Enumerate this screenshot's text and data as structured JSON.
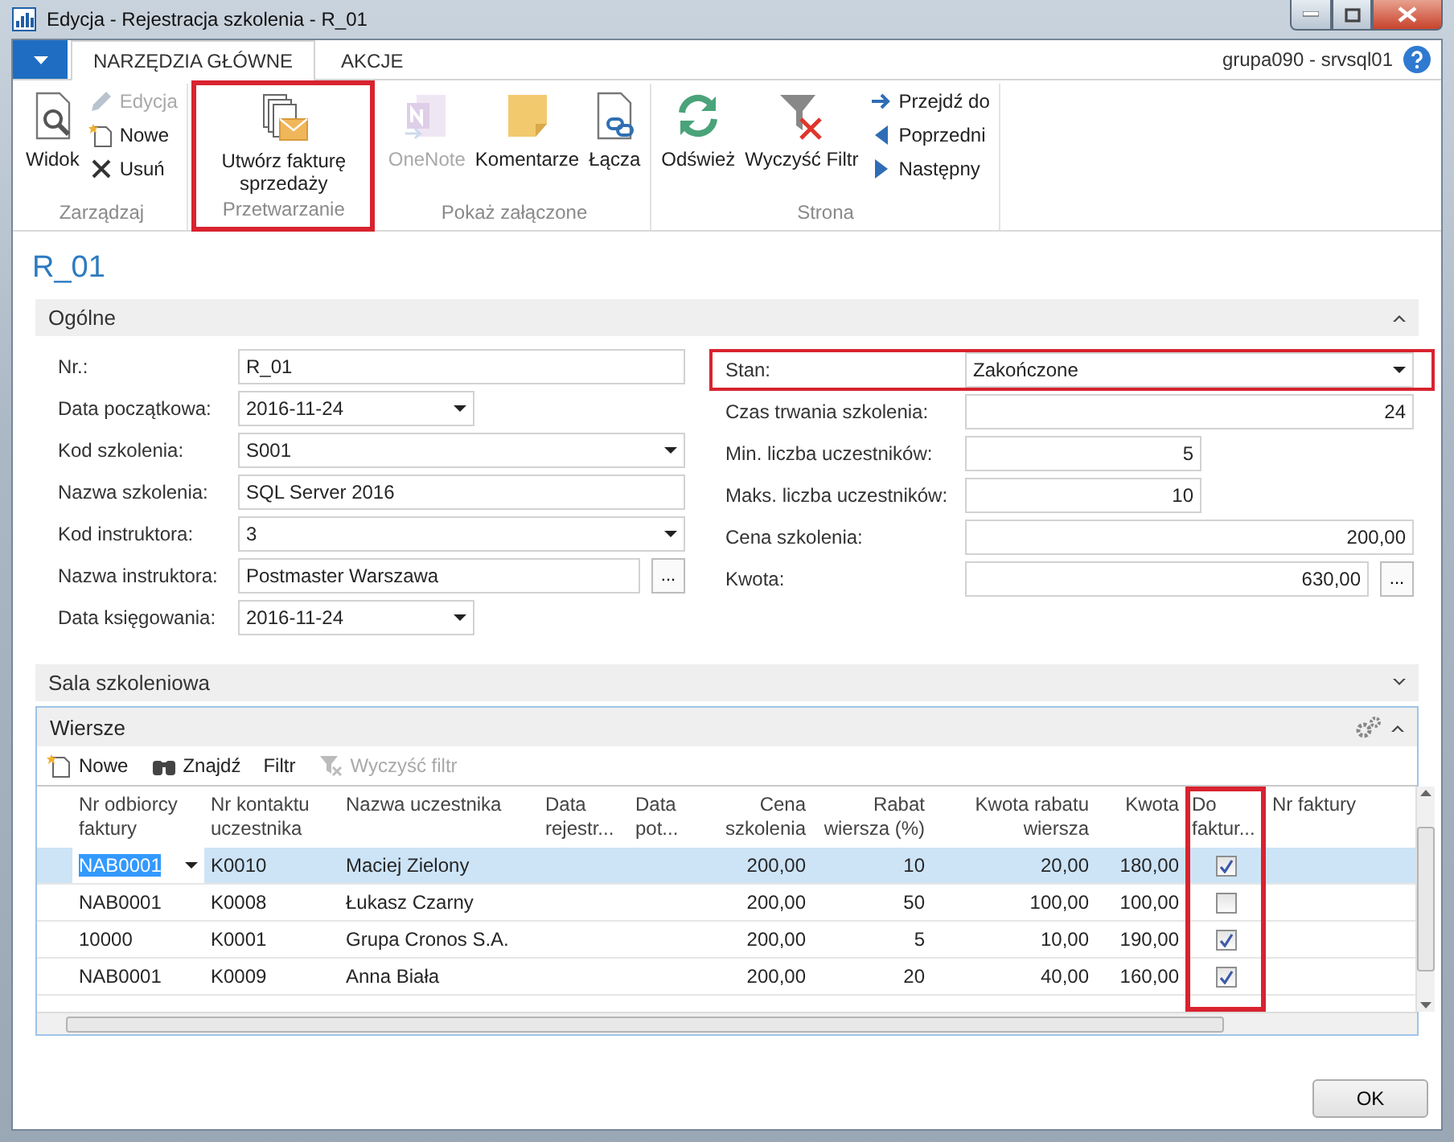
{
  "window": {
    "title": "Edycja - Rejestracja szkolenia - R_01"
  },
  "ribbon_tabs": [
    {
      "label": "NARZĘDZIA GŁÓWNE",
      "selected": true
    },
    {
      "label": "AKCJE",
      "selected": false
    }
  ],
  "user_info": "grupa090 - srvsql01",
  "ribbon_groups": [
    {
      "label": "Zarządzaj",
      "highlighted": false,
      "items": [
        {
          "label": "Widok",
          "kind": "large",
          "disabled": false
        },
        {
          "label": "Edycja",
          "kind": "small",
          "disabled": true
        },
        {
          "label": "Nowe",
          "kind": "small",
          "disabled": false
        },
        {
          "label": "Usuń",
          "kind": "small",
          "disabled": false
        }
      ]
    },
    {
      "label": "Przetwarzanie",
      "highlighted": true,
      "items": [
        {
          "label": "Utwórz fakturę sprzedaży",
          "kind": "large",
          "disabled": false
        }
      ]
    },
    {
      "label": "Pokaż załączone",
      "highlighted": false,
      "items": [
        {
          "label": "OneNote",
          "kind": "large",
          "disabled": true
        },
        {
          "label": "Komentarze",
          "kind": "large",
          "disabled": false
        },
        {
          "label": "Łącza",
          "kind": "large",
          "disabled": false
        }
      ]
    },
    {
      "label": "Strona",
      "highlighted": false,
      "items": [
        {
          "label": "Odśwież",
          "kind": "large",
          "disabled": false
        },
        {
          "label": "Wyczyść Filtr",
          "kind": "large",
          "disabled": false
        },
        {
          "label": "Przejdź do",
          "kind": "small",
          "disabled": false
        },
        {
          "label": "Poprzedni",
          "kind": "small",
          "disabled": false
        },
        {
          "label": "Następny",
          "kind": "small",
          "disabled": false
        }
      ]
    }
  ],
  "page_title": "R_01",
  "general": {
    "title": "Ogólne",
    "expanded": true,
    "left_fields": [
      {
        "label": "Nr.:",
        "value": "R_01",
        "kind": "text",
        "highlighted": false
      },
      {
        "label": "Data początkowa:",
        "value": "2016-11-24",
        "kind": "date",
        "highlighted": false
      },
      {
        "label": "Kod szkolenia:",
        "value": "S001",
        "kind": "dropdown",
        "highlighted": false
      },
      {
        "label": "Nazwa szkolenia:",
        "value": "SQL Server 2016",
        "kind": "text",
        "highlighted": false
      },
      {
        "label": "Kod instruktora:",
        "value": "3",
        "kind": "dropdown",
        "highlighted": false
      },
      {
        "label": "Nazwa instruktora:",
        "value": "Postmaster Warszawa",
        "kind": "lookup",
        "button": "...",
        "highlighted": false
      },
      {
        "label": "Data księgowania:",
        "value": "2016-11-24",
        "kind": "date",
        "highlighted": false
      }
    ],
    "right_fields": [
      {
        "label": "Stan:",
        "value": "Zakończone",
        "kind": "dropdown",
        "highlighted": true
      },
      {
        "label": "Czas trwania szkolenia:",
        "value": "24",
        "kind": "number",
        "highlighted": false
      },
      {
        "label": "Min. liczba uczestników:",
        "value": "5",
        "kind": "short_number",
        "highlighted": false
      },
      {
        "label": "Maks. liczba uczestników:",
        "value": "10",
        "kind": "short_number",
        "highlighted": false
      },
      {
        "label": "Cena szkolenia:",
        "value": "200,00",
        "kind": "number",
        "highlighted": false
      },
      {
        "label": "Kwota:",
        "value": "630,00",
        "kind": "number_lookup",
        "button": "...",
        "highlighted": false
      }
    ]
  },
  "room": {
    "title": "Sala szkoleniowa",
    "expanded": false
  },
  "lines": {
    "title": "Wiersze",
    "expanded": true,
    "actions": [
      {
        "label": "Nowe",
        "disabled": false
      },
      {
        "label": "Znajdź",
        "disabled": false
      },
      {
        "label": "Filtr",
        "disabled": false
      },
      {
        "label": "Wyczyść filtr",
        "disabled": true
      }
    ],
    "columns": [
      {
        "label": "Nr odbiorcy faktury",
        "kind": "text",
        "highlighted": false
      },
      {
        "label": "Nr kontaktu uczestnika",
        "kind": "text",
        "highlighted": false
      },
      {
        "label": "Nazwa uczestnika",
        "kind": "text",
        "highlighted": false
      },
      {
        "label": "Data rejestr...",
        "kind": "text",
        "highlighted": false
      },
      {
        "label": "Data pot...",
        "kind": "text",
        "highlighted": false
      },
      {
        "label": "Cena szkolenia",
        "kind": "number",
        "highlighted": false
      },
      {
        "label": "Rabat wiersza (%)",
        "kind": "number",
        "highlighted": false
      },
      {
        "label": "Kwota rabatu wiersza",
        "kind": "number",
        "highlighted": false
      },
      {
        "label": "Kwota",
        "kind": "number",
        "highlighted": false
      },
      {
        "label": "Do faktur...",
        "kind": "check",
        "highlighted": true
      },
      {
        "label": "Nr faktury",
        "kind": "text",
        "highlighted": false
      }
    ],
    "rows": [
      {
        "selected": true,
        "to_invoice": true,
        "cells": [
          "NAB0001",
          "K0010",
          "Maciej Zielony",
          null,
          null,
          "200,00",
          "10",
          "20,00",
          "180,00",
          null,
          null
        ]
      },
      {
        "selected": false,
        "to_invoice": false,
        "cells": [
          "NAB0001",
          "K0008",
          "Łukasz Czarny",
          null,
          null,
          "200,00",
          "50",
          "100,00",
          "100,00",
          null,
          null
        ]
      },
      {
        "selected": false,
        "to_invoice": true,
        "cells": [
          "10000",
          "K0001",
          "Grupa Cronos S.A.",
          null,
          null,
          "200,00",
          "5",
          "10,00",
          "190,00",
          null,
          null
        ]
      },
      {
        "selected": false,
        "to_invoice": true,
        "cells": [
          "NAB0001",
          "K0009",
          "Anna Biała",
          null,
          null,
          "200,00",
          "20",
          "40,00",
          "160,00",
          null,
          null
        ]
      }
    ]
  },
  "buttons": [
    {
      "label": "OK"
    }
  ]
}
